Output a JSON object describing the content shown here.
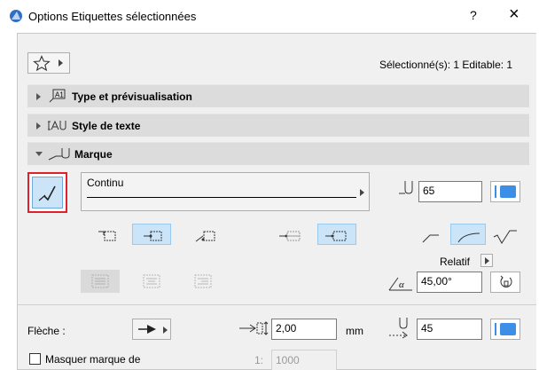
{
  "window": {
    "title": "Options Etiquettes sélectionnées",
    "help_label": "?",
    "close_label": "×"
  },
  "toolbar": {
    "selection_status": "Sélectionné(s): 1 Editable: 1"
  },
  "sections": {
    "type_preview": "Type et prévisualisation",
    "text_style": "Style de texte",
    "marker": "Marque"
  },
  "marker": {
    "line_type": "Continu",
    "pen_value": "65",
    "relatif_label": "Relatif",
    "angle_value": "45,00°"
  },
  "arrow": {
    "label": "Flèche :",
    "size_value": "2,00",
    "size_unit": "mm",
    "pen_value": "45"
  },
  "hide_marker": {
    "label": "Masquer marque de",
    "scale_prefix": "1:",
    "scale_value": "1000",
    "checked": false
  },
  "colors": {
    "accent": "#3c8ee6",
    "highlight": "#cce4f7",
    "red_frame": "#e0202a"
  }
}
